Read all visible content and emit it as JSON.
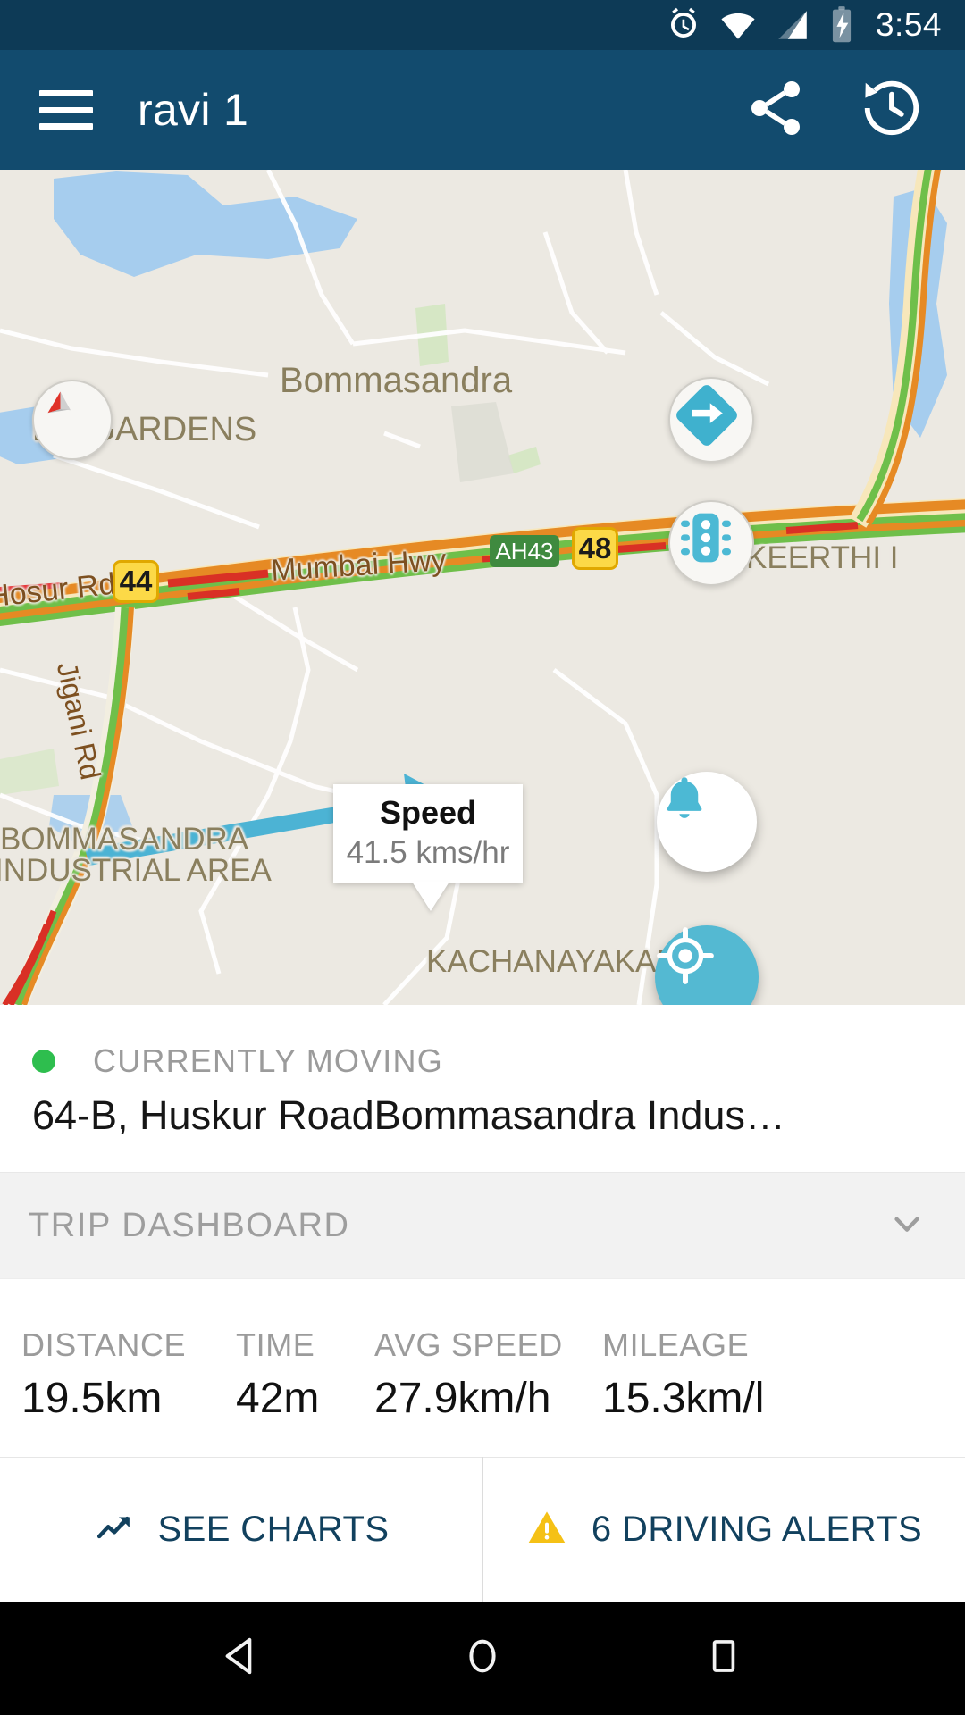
{
  "statusbar": {
    "time": "3:54",
    "icons": [
      "alarm-icon",
      "wifi-icon",
      "signal-icon",
      "battery-charging-icon"
    ]
  },
  "appbar": {
    "menu_icon": "hamburger-menu-icon",
    "title": "ravi 1",
    "share_icon": "share-icon",
    "history_icon": "history-icon",
    "bg_color": "#124b6e"
  },
  "map": {
    "area_labels": [
      {
        "text": "Bommasandra"
      },
      {
        "text": "RS GARDENS"
      },
      {
        "text": "BOMMASANDRA"
      },
      {
        "text": "INDUSTRIAL AREA"
      },
      {
        "text": "KACHANAYAKANAH"
      },
      {
        "text": "KEERTHI I"
      }
    ],
    "road_labels": [
      {
        "text": "Mumbai Hwy"
      },
      {
        "text": "Hosur Rd"
      },
      {
        "text": "Jigani Rd"
      }
    ],
    "shields": [
      {
        "text": "44"
      },
      {
        "text": "48"
      },
      {
        "text": "AH43"
      }
    ],
    "compass_icon": "compass-needle-icon",
    "direction_button_icon": "turn-right-direction-icon",
    "traffic_button_icon": "traffic-light-icon",
    "bell_fab_icon": "bell-notification-icon",
    "locate_fab_icon": "my-location-icon",
    "accent_color": "#54b9d2",
    "tooltip": {
      "title": "Speed",
      "value": "41.5 kms/hr"
    }
  },
  "info": {
    "status_label": "CURRENTLY MOVING",
    "status_color": "#2ebe4e",
    "address": "64-B, Huskur RoadBommasandra Indus…"
  },
  "dashboard": {
    "title": "TRIP DASHBOARD",
    "chevron_icon": "chevron-down-icon"
  },
  "stats": [
    {
      "label": "DISTANCE",
      "value": "19.5km"
    },
    {
      "label": "TIME",
      "value": "42m"
    },
    {
      "label": "AVG SPEED",
      "value": "27.9km/h"
    },
    {
      "label": "MILEAGE",
      "value": "15.3km/l"
    }
  ],
  "actions": [
    {
      "label": "SEE CHARTS",
      "icon": "trending-up-chart-icon",
      "icon_color": "#12415e"
    },
    {
      "label": "6 DRIVING ALERTS",
      "icon": "warning-triangle-icon",
      "icon_color": "#f5c116"
    }
  ],
  "navbar": {
    "back_icon": "android-back-icon",
    "home_icon": "android-home-icon",
    "recents_icon": "android-recents-icon"
  }
}
